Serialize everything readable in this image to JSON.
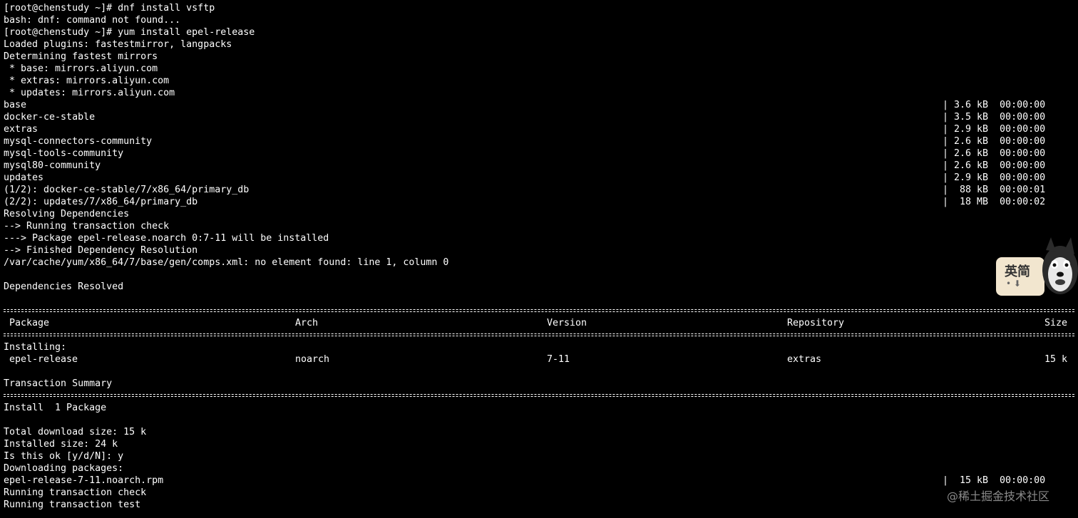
{
  "terminal": {
    "lines": [
      "[root@chenstudy ~]# dnf install vsftp",
      "bash: dnf: command not found...",
      "[root@chenstudy ~]# yum install epel-release",
      "Loaded plugins: fastestmirror, langpacks",
      "Determining fastest mirrors",
      " * base: mirrors.aliyun.com",
      " * extras: mirrors.aliyun.com",
      " * updates: mirrors.aliyun.com"
    ],
    "repos": [
      {
        "name": "base",
        "stat": "| 3.6 kB  00:00:00"
      },
      {
        "name": "docker-ce-stable",
        "stat": "| 3.5 kB  00:00:00"
      },
      {
        "name": "extras",
        "stat": "| 2.9 kB  00:00:00"
      },
      {
        "name": "mysql-connectors-community",
        "stat": "| 2.6 kB  00:00:00"
      },
      {
        "name": "mysql-tools-community",
        "stat": "| 2.6 kB  00:00:00"
      },
      {
        "name": "mysql80-community",
        "stat": "| 2.6 kB  00:00:00"
      },
      {
        "name": "updates",
        "stat": "| 2.9 kB  00:00:00"
      },
      {
        "name": "(1/2): docker-ce-stable/7/x86_64/primary_db",
        "stat": "|  88 kB  00:00:01"
      },
      {
        "name": "(2/2): updates/7/x86_64/primary_db",
        "stat": "|  18 MB  00:00:02"
      }
    ],
    "resolve_lines": [
      "Resolving Dependencies",
      "--> Running transaction check",
      "---> Package epel-release.noarch 0:7-11 will be installed",
      "--> Finished Dependency Resolution",
      "/var/cache/yum/x86_64/7/base/gen/comps.xml: no element found: line 1, column 0",
      "",
      "Dependencies Resolved",
      ""
    ],
    "table": {
      "headers": {
        "package": "Package",
        "arch": "Arch",
        "version": "Version",
        "repository": "Repository",
        "size": "Size"
      },
      "installing_label": "Installing:",
      "row": {
        "package": "epel-release",
        "arch": "noarch",
        "version": "7-11",
        "repository": "extras",
        "size": "15 k"
      }
    },
    "transaction_summary": "Transaction Summary",
    "install_count": "Install  1 Package",
    "tail_lines": [
      "",
      "Total download size: 15 k",
      "Installed size: 24 k",
      "Is this ok [y/d/N]: y",
      "Downloading packages:"
    ],
    "download": {
      "name": "epel-release-7-11.noarch.rpm",
      "stat": "|  15 kB  00:00:00"
    },
    "final_lines": [
      "Running transaction check",
      "Running transaction test"
    ]
  },
  "badge": {
    "text": "英简",
    "icons": "• ⬇",
    "mascot": "husky-dog-icon"
  },
  "watermark": "@稀土掘金技术社区",
  "colors": {
    "background": "#000000",
    "foreground": "#ffffff",
    "watermark": "#8a8a8a",
    "badge_bg": "#f2e6cf"
  }
}
